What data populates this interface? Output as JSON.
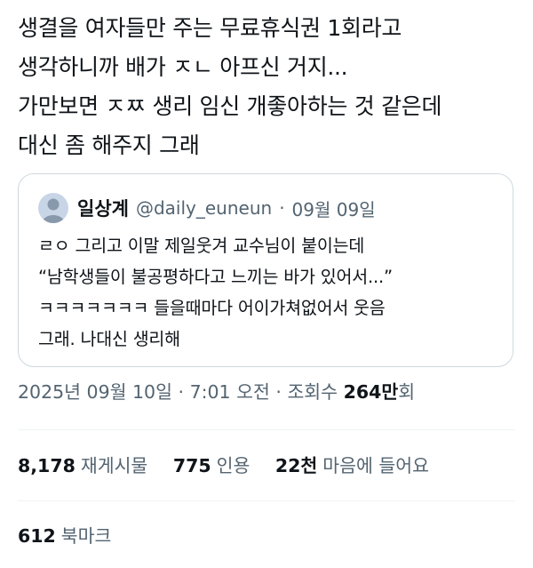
{
  "tweet": {
    "lines": [
      "생결을 여자들만 주는 무료휴식권 1회라고",
      "생각하니까 배가 ㅈㄴ 아프신 거지...",
      "가만보면 ㅈㅉ 생리 임신 개좋아하는 것 같은데",
      "대신 좀 해주지 그래"
    ]
  },
  "quote": {
    "name": "일상계",
    "handle": "@daily_euneun",
    "separator": "·",
    "date": "09월 09일",
    "lines": [
      "ㄹㅇ 그리고 이말 제일웃겨 교수님이 붙이는데",
      "“남학생들이 불공평하다고 느끼는 바가 있어서...”",
      "ㅋㅋㅋㅋㅋㅋㅋ 들을때마다 어이가쳐없어서 웃음",
      "그래. 나대신 생리해"
    ]
  },
  "meta": {
    "date": "2025년 09월 10일",
    "time": "7:01 오전",
    "views_label": "조회수",
    "views_count": "264만",
    "views_suffix": "회",
    "separator": "·"
  },
  "stats": {
    "retweets_count": "8,178",
    "retweets_label": "재게시물",
    "quotes_count": "775",
    "quotes_label": "인용",
    "likes_count": "22천",
    "likes_label": "마음에 들어요",
    "bookmarks_count": "612",
    "bookmarks_label": "북마크"
  }
}
